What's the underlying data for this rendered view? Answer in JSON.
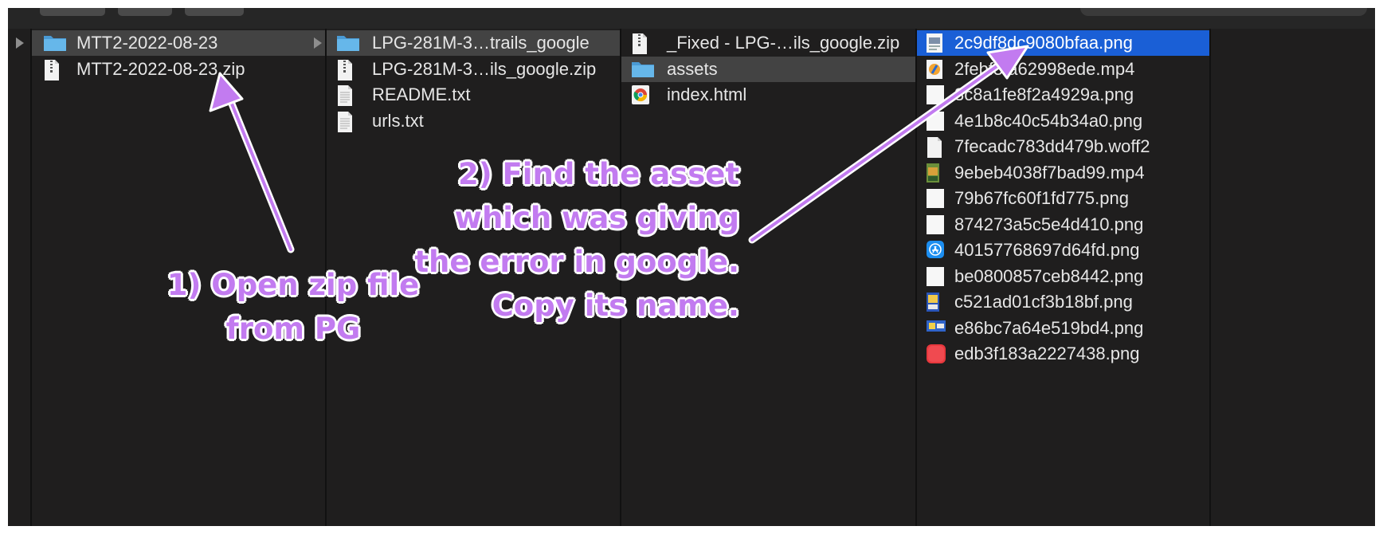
{
  "column1": {
    "items": [
      {
        "label": "MTT2-2022-08-23",
        "icon": "folder-icon",
        "expandable": true,
        "selected": "gray"
      },
      {
        "label": "MTT2-2022-08-23.zip",
        "icon": "zip-file-icon",
        "expandable": false,
        "selected": "none"
      }
    ]
  },
  "column2": {
    "items": [
      {
        "label": "LPG-281M-3…trails_google",
        "icon": "folder-icon",
        "expandable": true,
        "selected": "gray"
      },
      {
        "label": "LPG-281M-3…ils_google.zip",
        "icon": "zip-file-icon",
        "expandable": false,
        "selected": "none"
      },
      {
        "label": "README.txt",
        "icon": "text-file-icon",
        "expandable": false,
        "selected": "none"
      },
      {
        "label": "urls.txt",
        "icon": "text-file-icon",
        "expandable": false,
        "selected": "none"
      }
    ]
  },
  "column3": {
    "items": [
      {
        "label": "_Fixed - LPG-…ils_google.zip",
        "icon": "zip-file-icon",
        "expandable": false,
        "selected": "none"
      },
      {
        "label": "assets",
        "icon": "folder-icon",
        "expandable": false,
        "selected": "gray"
      },
      {
        "label": "index.html",
        "icon": "chrome-html-icon",
        "expandable": false,
        "selected": "none"
      }
    ]
  },
  "column4": {
    "items": [
      {
        "label": "2c9df8dc9080bfaa.png",
        "icon": "image-thumb-icon",
        "selected": "blue"
      },
      {
        "label": "2febf5fa62998ede.mp4",
        "icon": "video-file-icon",
        "selected": "none"
      },
      {
        "label": "3c8a1fe8f2a4929a.png",
        "icon": "blank-image-icon",
        "selected": "none"
      },
      {
        "label": "4e1b8c40c54b34a0.png",
        "icon": "blank-image-icon",
        "selected": "none"
      },
      {
        "label": "7fecadc783dd479b.woff2",
        "icon": "document-icon",
        "selected": "none"
      },
      {
        "label": "9ebeb4038f7bad99.mp4",
        "icon": "video-thumb-icon",
        "selected": "none"
      },
      {
        "label": "79b67fc60f1fd775.png",
        "icon": "blank-image-icon",
        "selected": "none"
      },
      {
        "label": "874273a5c5e4d410.png",
        "icon": "blank-image-icon",
        "selected": "none"
      },
      {
        "label": "40157768697d64fd.png",
        "icon": "app-store-icon",
        "selected": "none"
      },
      {
        "label": "be0800857ceb8442.png",
        "icon": "blank-image-icon",
        "selected": "none"
      },
      {
        "label": "c521ad01cf3b18bf.png",
        "icon": "poster-thumb-icon",
        "selected": "none"
      },
      {
        "label": "e86bc7a64e519bd4.png",
        "icon": "banner-thumb-icon",
        "selected": "none"
      },
      {
        "label": "edb3f183a2227438.png",
        "icon": "red-square-icon",
        "selected": "none"
      }
    ]
  },
  "annotations": {
    "step1": [
      "1) Open zip file",
      "from PG"
    ],
    "step2": [
      "2) Find the asset",
      "which was giving",
      "the error in google.",
      "Copy its name."
    ],
    "color": "#c27bf0"
  },
  "colors": {
    "window_bg": "#1f1e1e",
    "selection_gray": "#434343",
    "selection_blue": "#1a5fd6",
    "folder_blue": "#5ab0e6",
    "text": "#e6e6e6"
  }
}
